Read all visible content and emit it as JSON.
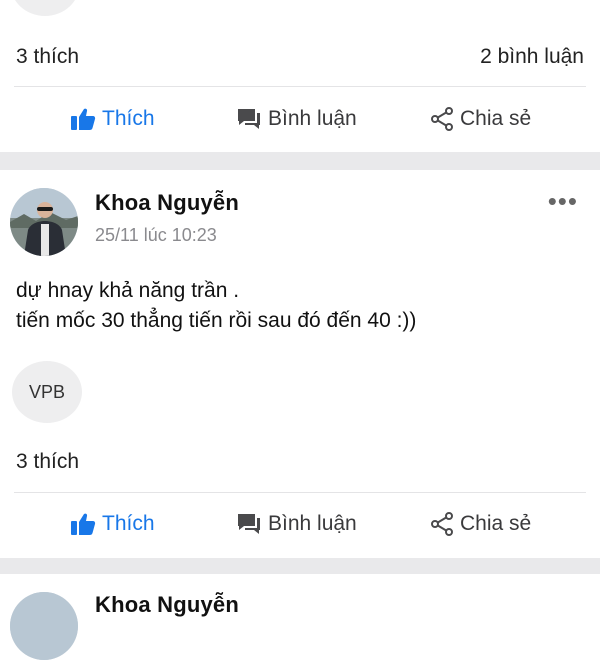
{
  "post_top": {
    "likes": "3 thích",
    "comments": "2 bình luận"
  },
  "actions": {
    "like": "Thích",
    "comment": "Bình luận",
    "share": "Chia sẻ"
  },
  "post": {
    "author": "Khoa Nguyễn",
    "timestamp": "25/11 lúc 10:23",
    "content_line1": "dự hnay khả năng trần .",
    "content_line2": "tiến mốc 30 thẳng tiến rồi sau đó đến 40 :))",
    "tag": "VPB",
    "likes": "3 thích",
    "more": "•••"
  },
  "post_next": {
    "author": "Khoa Nguyễn"
  },
  "colors": {
    "like_blue": "#1877e8",
    "band_gray": "#e9e9eb",
    "muted_text": "#8a8a8e"
  }
}
